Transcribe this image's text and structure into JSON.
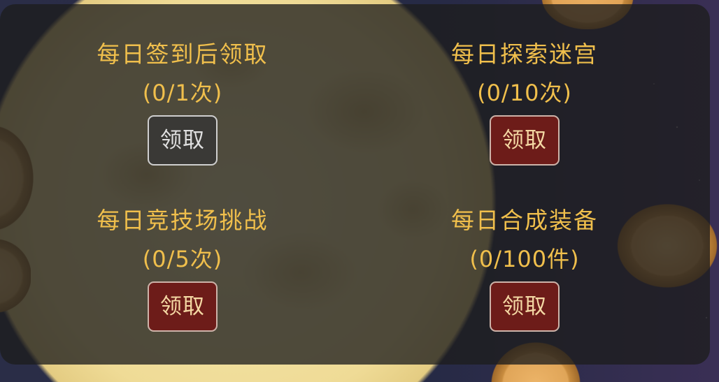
{
  "panel": {
    "tasks": [
      {
        "title": "每日签到后领取",
        "progress": "(0/1次)",
        "button_label": "领取",
        "button_state": "disabled"
      },
      {
        "title": "每日探索迷宫",
        "progress": "(0/10次)",
        "button_label": "领取",
        "button_state": "active"
      },
      {
        "title": "每日竞技场挑战",
        "progress": "(0/5次)",
        "button_label": "领取",
        "button_state": "active"
      },
      {
        "title": "每日合成装备",
        "progress": "(0/100件)",
        "button_label": "领取",
        "button_state": "active"
      }
    ]
  },
  "colors": {
    "title_text": "#f0bf4c",
    "button_bg": "#6d1c19",
    "button_text": "#f4d8a4",
    "button_disabled_bg": "#3a3936",
    "button_disabled_text": "#e0e0e0",
    "panel_bg": "#1c1c1c"
  }
}
